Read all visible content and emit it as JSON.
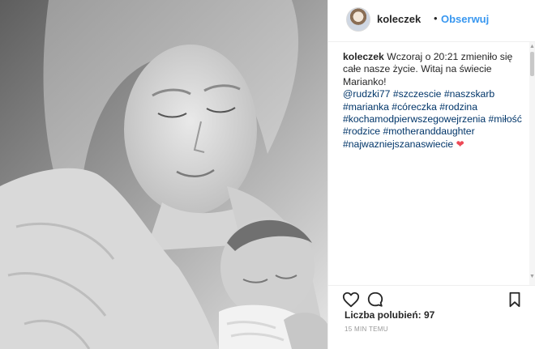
{
  "post": {
    "image_alt": "Black and white photo of a mother holding a newborn baby",
    "username": "koleczek",
    "separator": "•",
    "follow_label": "Obserwuj"
  },
  "caption": {
    "username": "koleczek",
    "text": "Wczoraj o 20:21 zmieniło się całe nasze życie. Witaj na świecie Marianko!",
    "tags": [
      "@rudzki77",
      "#szczescie",
      "#naszskarb",
      "#marianka",
      "#córeczka",
      "#rodzina",
      "#kochamodpierwszegowejrzenia",
      "#miłość",
      "#rodzice",
      "#motheranddaughter",
      "#najwazniejszanaswiecie"
    ],
    "emoji": "❤"
  },
  "actions": {
    "like_icon": "heart-outline-icon",
    "comment_icon": "comment-bubble-icon",
    "save_icon": "bookmark-icon"
  },
  "likes": {
    "text": "Liczba polubień: 97"
  },
  "timestamp": "15 MIN TEMU",
  "colors": {
    "follow": "#3897f0",
    "tag": "#003569",
    "heart": "#ed4956",
    "muted": "#999999"
  }
}
